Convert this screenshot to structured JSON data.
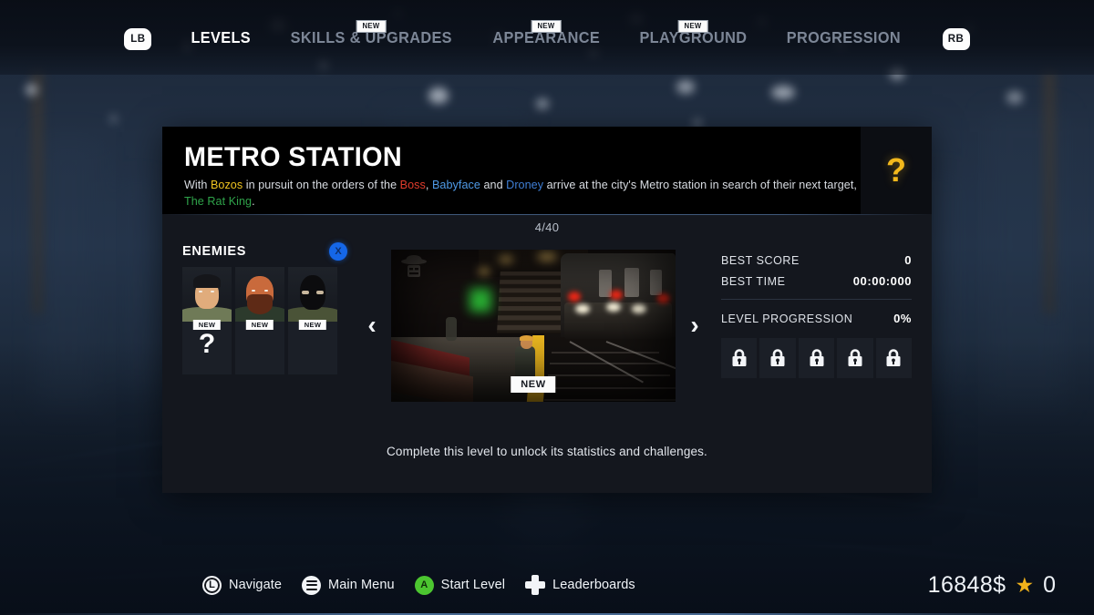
{
  "nav": {
    "left_bumper": "LB",
    "right_bumper": "RB",
    "tabs": [
      {
        "label": "LEVELS",
        "active": true,
        "badge": ""
      },
      {
        "label": "SKILLS & UPGRADES",
        "active": false,
        "badge": "NEW"
      },
      {
        "label": "APPEARANCE",
        "active": false,
        "badge": "NEW"
      },
      {
        "label": "PLAYGROUND",
        "active": false,
        "badge": "NEW"
      },
      {
        "label": "PROGRESSION",
        "active": false,
        "badge": ""
      }
    ]
  },
  "level": {
    "title": "METRO STATION",
    "counter": "4/40",
    "help_icon": "question-mark-icon",
    "description": {
      "full": "With Bozos in pursuit on the orders of the Boss, Babyface and Droney arrive at the city's Metro station in search of their next target, The Rat King.",
      "p1": "With ",
      "bozos": "Bozos",
      "p2": " in pursuit on the orders of the ",
      "boss": "Boss",
      "p3": ", ",
      "babyface": "Babyface",
      "p4": " and ",
      "droney": "Droney",
      "p5": " arrive at the city's Metro station in search of their next target, ",
      "ratking": "The Rat King",
      "p6": "."
    },
    "preview_badge": "NEW",
    "prev_arrow": "‹",
    "next_arrow": "›"
  },
  "enemies": {
    "title": "ENEMIES",
    "toggle_label": "X",
    "items": [
      {
        "name": "cap-thug",
        "badge": "NEW",
        "locked_extra": "?"
      },
      {
        "name": "bearded-brute",
        "badge": "NEW",
        "locked_extra": ""
      },
      {
        "name": "balaclava-man",
        "badge": "NEW",
        "locked_extra": ""
      }
    ]
  },
  "stats": {
    "rows": [
      {
        "label": "BEST SCORE",
        "value": "0"
      },
      {
        "label": "BEST TIME",
        "value": "00:00:000"
      }
    ],
    "progression_label": "LEVEL PROGRESSION",
    "progression_value": "0%",
    "locks": [
      "lock-icon",
      "lock-icon",
      "lock-icon",
      "lock-icon",
      "lock-icon"
    ]
  },
  "note": "Complete this level to unlock its statistics and challenges.",
  "footer": {
    "hints": [
      {
        "icon": "left-stick-icon",
        "glyph": "L",
        "label": "Navigate"
      },
      {
        "icon": "menu-icon",
        "glyph": "",
        "label": "Main Menu"
      },
      {
        "icon": "a-button-icon",
        "glyph": "A",
        "label": "Start Level"
      },
      {
        "icon": "dpad-icon",
        "glyph": "",
        "label": "Leaderboards"
      }
    ],
    "money": "16848$",
    "star_icon": "star-icon",
    "stars": "0"
  },
  "colors": {
    "accent_yellow": "#f2b81c",
    "boss_red": "#e23c2c",
    "babyface_blue": "#4f9ae6",
    "droney_blue": "#3f7fd6",
    "ratking_green": "#2fa34a",
    "a_button_green": "#4cc630",
    "toggle_blue": "#1567e8",
    "panel_bg": "#14171e"
  }
}
